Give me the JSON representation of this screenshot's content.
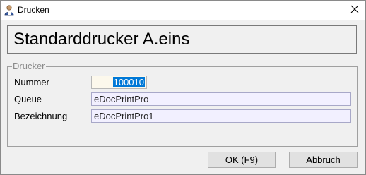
{
  "window": {
    "title": "Drucken",
    "icons": {
      "app": "printer-user-icon",
      "close": "close-icon"
    }
  },
  "header": {
    "title": "Standarddrucker A.eins"
  },
  "group": {
    "legend": "Drucker",
    "fields": {
      "nummer": {
        "label": "Nummer",
        "value": "100010"
      },
      "queue": {
        "label": "Queue",
        "value": "eDocPrintPro"
      },
      "bezeichnung": {
        "label": "Bezeichnung",
        "value": "eDocPrintPro1"
      }
    }
  },
  "buttons": {
    "ok": {
      "accel": "O",
      "rest": "K (F9)"
    },
    "cancel": {
      "accel": "A",
      "rest": "bbruch"
    }
  },
  "colors": {
    "selection": "#0078d7",
    "field_bg": "#f2f0ff",
    "window_bg": "#f0f0f0"
  }
}
